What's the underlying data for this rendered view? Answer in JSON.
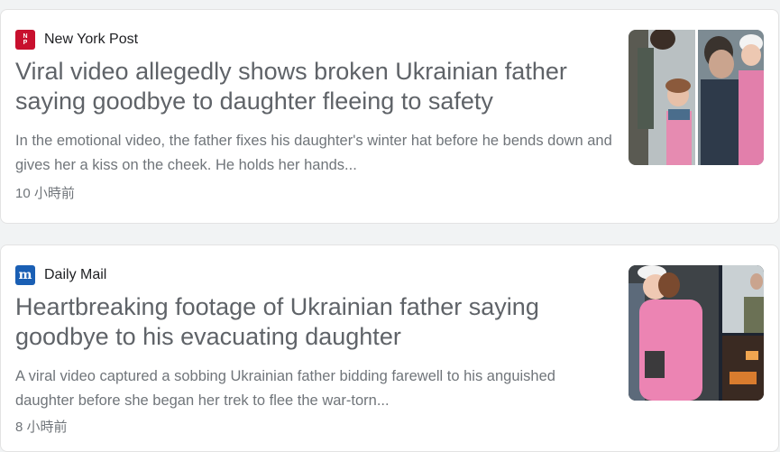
{
  "articles": [
    {
      "source": "New York Post",
      "title": "Viral video allegedly shows broken Ukrainian father saying goodbye to daughter fleeing to safety",
      "snippet": "In the emotional video, the father fixes his daughter's winter hat before he bends down and gives her a kiss on the cheek. He holds her hands...",
      "time": "10 小時前",
      "favicon_icon": "new-york-post-logo-icon",
      "favicon_color": "#c8102e"
    },
    {
      "source": "Daily Mail",
      "title": "Heartbreaking footage of Ukrainian father saying goodbye to his evacuating daughter",
      "snippet": "A viral video captured a sobbing Ukrainian father bidding farewell to his anguished daughter before she began her trek to flee the war-torn...",
      "time": "8 小時前",
      "favicon_icon": "daily-mail-logo-icon",
      "favicon_color": "#1a5fb4"
    }
  ]
}
